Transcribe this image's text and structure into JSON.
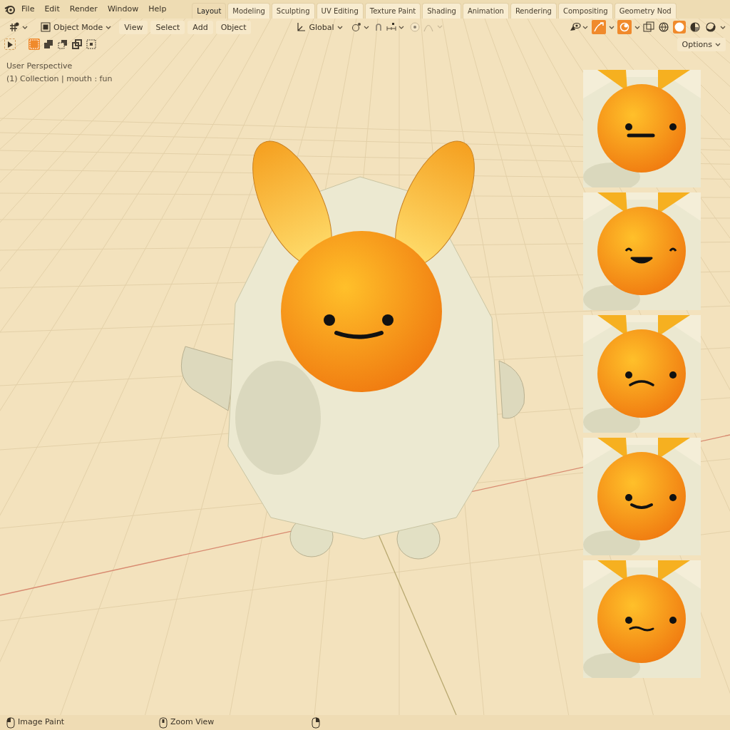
{
  "menu": [
    "File",
    "Edit",
    "Render",
    "Window",
    "Help"
  ],
  "workspace_tabs": [
    {
      "label": "Layout",
      "selected": true
    },
    {
      "label": "Modeling",
      "selected": false
    },
    {
      "label": "Sculpting",
      "selected": false
    },
    {
      "label": "UV Editing",
      "selected": false
    },
    {
      "label": "Texture Paint",
      "selected": false
    },
    {
      "label": "Shading",
      "selected": false
    },
    {
      "label": "Animation",
      "selected": false
    },
    {
      "label": "Rendering",
      "selected": false
    },
    {
      "label": "Compositing",
      "selected": false
    },
    {
      "label": "Geometry Nod",
      "selected": false
    }
  ],
  "header": {
    "mode": "Object Mode",
    "menus": [
      "View",
      "Select",
      "Add",
      "Object"
    ],
    "orientation": "Global"
  },
  "shading_modes": [
    {
      "kind": "wireframe",
      "selected": false
    },
    {
      "kind": "solid",
      "selected": true
    },
    {
      "kind": "material",
      "selected": false
    },
    {
      "kind": "rendered",
      "selected": false
    }
  ],
  "select_modes": [
    {
      "kind": "new",
      "selected": true
    },
    {
      "kind": "extend",
      "selected": false
    },
    {
      "kind": "subtract",
      "selected": false
    },
    {
      "kind": "invert",
      "selected": false
    },
    {
      "kind": "intersect",
      "selected": false
    }
  ],
  "options": "Options",
  "overlay": {
    "view_name": "User Perspective",
    "collection": "(1) Collection | mouth : fun"
  },
  "thumbnails": [
    {
      "kind": "flat"
    },
    {
      "kind": "grin"
    },
    {
      "kind": "frown"
    },
    {
      "kind": "smile"
    },
    {
      "kind": "wavy"
    }
  ],
  "status_bar": [
    "Image Paint",
    "Zoom View"
  ]
}
